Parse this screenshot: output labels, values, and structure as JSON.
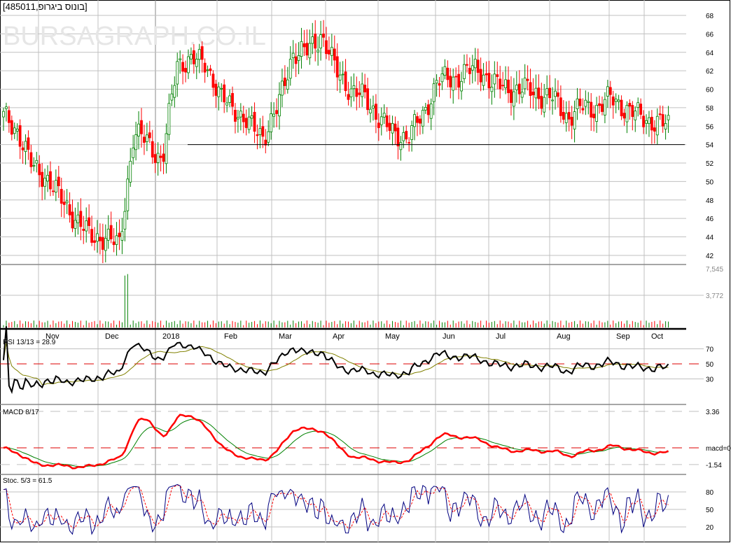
{
  "header": {
    "title": "[485011,בונוס ביגרופ]",
    "watermark": "BURSAGRAPH.CO.IL"
  },
  "chart_data": {
    "type": "candlestick",
    "price_axis": {
      "ticks": [
        "68",
        "66",
        "64",
        "62",
        "60",
        "58",
        "56",
        "54",
        "52",
        "50",
        "48",
        "46",
        "44",
        "42"
      ],
      "range": [
        42,
        68
      ]
    },
    "support_level": 54,
    "months": [
      "Nov",
      "Dec",
      "2018",
      "Feb",
      "Mar",
      "Apr",
      "May",
      "Jun",
      "Jul",
      "Aug",
      "Sep",
      "Oct"
    ],
    "approx_close_path": [
      57,
      55.5,
      51.5,
      50.5,
      48,
      46,
      44,
      44,
      43,
      55,
      54.5,
      52,
      63,
      63,
      63,
      59,
      58,
      56,
      55,
      58,
      64,
      64,
      66,
      62,
      60,
      59,
      57,
      55,
      55,
      57,
      61,
      61,
      62,
      62,
      60.5,
      60,
      60,
      59.5,
      59,
      57,
      58,
      58,
      59,
      58,
      57,
      56.5,
      56
    ],
    "volume": {
      "ticks": [
        "7,545",
        "3,772"
      ]
    },
    "rsi": {
      "label": "RSI 13/13 = 28.9",
      "ticks": [
        "70",
        "50",
        "30"
      ]
    },
    "macd": {
      "label": "MACD 8/17",
      "ticks": [
        "3.36",
        "macd=0",
        "-1.54"
      ]
    },
    "stoch": {
      "label": "Stoc. 5/3 = 61.5",
      "ticks": [
        "80",
        "50",
        "20"
      ]
    }
  },
  "colors": {
    "up": "#008000",
    "down": "#ff0000",
    "grid": "#c0c0c0",
    "rsi": "#000000",
    "signal": "#808000",
    "macd": "#ff0000",
    "macd_signal": "#008000",
    "stochK": "#000080",
    "stochD": "#ff0000"
  }
}
